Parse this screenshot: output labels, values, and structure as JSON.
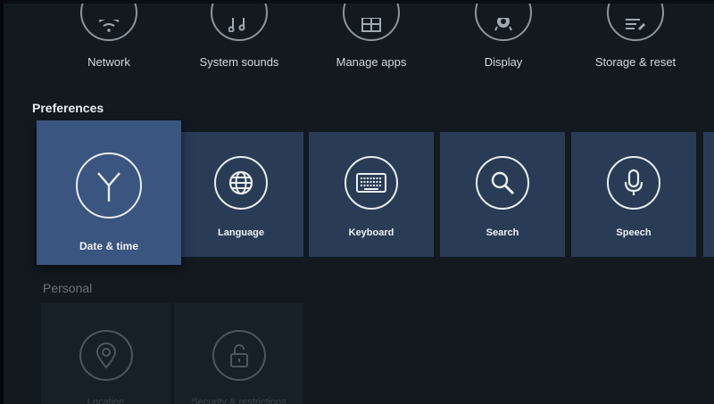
{
  "device": {
    "items": [
      {
        "label": "Network",
        "icon": "wifi-icon"
      },
      {
        "label": "System sounds",
        "icon": "music-note-icon"
      },
      {
        "label": "Manage apps",
        "icon": "apps-grid-icon"
      },
      {
        "label": "Display",
        "icon": "display-gear-icon"
      },
      {
        "label": "Storage & reset",
        "icon": "storage-icon"
      }
    ]
  },
  "preferences": {
    "title": "Preferences",
    "items": [
      {
        "label": "Date & time",
        "icon": "clock-icon",
        "selected": true
      },
      {
        "label": "Language",
        "icon": "globe-icon"
      },
      {
        "label": "Keyboard",
        "icon": "keyboard-icon"
      },
      {
        "label": "Search",
        "icon": "search-icon"
      },
      {
        "label": "Speech",
        "icon": "microphone-icon"
      }
    ]
  },
  "personal": {
    "title": "Personal",
    "items": [
      {
        "label": "Location",
        "icon": "location-pin-icon"
      },
      {
        "label": "Security & restrictions",
        "icon": "lock-icon"
      }
    ]
  },
  "colors": {
    "background": "#121a20",
    "tile": "#2a3c55",
    "tile_selected": "#3a5580"
  }
}
